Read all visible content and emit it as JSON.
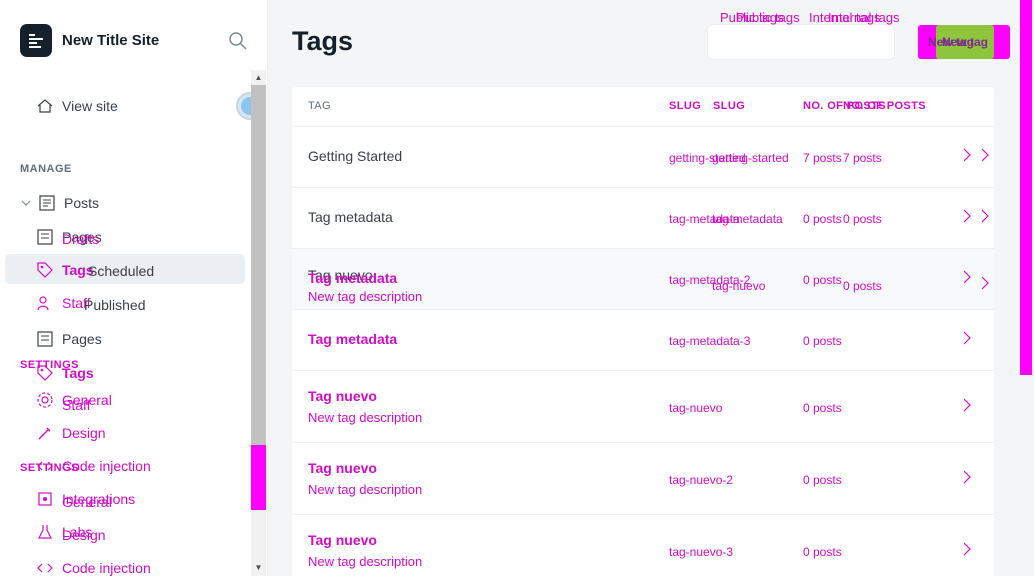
{
  "sidebar": {
    "site_title": "New Title Site",
    "view_site": "View site",
    "manage_label": "MANAGE",
    "settings_label_1": "SETTINGS",
    "settings_label_2": "SETTINGS",
    "posts": "Posts",
    "pages_ghost": "Pages",
    "drafts": "Drafts",
    "tags_ghost": "Tags",
    "scheduled": "Scheduled",
    "staff_ghost": "Staff",
    "published": "Published",
    "pages": "Pages",
    "tags": "Tags",
    "staff": "Staff",
    "general_1": "General",
    "design_1": "Design",
    "code_injection_1": "Code injection",
    "integrations": "Integrations",
    "general_2": "General",
    "labs": "Labs",
    "design_2": "Design",
    "code_injection_2": "Code injection"
  },
  "header": {
    "title": "Tags",
    "public_tags_1": "Public tags",
    "public_tags_2": "Public tags",
    "internal_tags_1": "Internal tags",
    "internal_tags_2": "Internal tags",
    "new_tag_1": "New tag",
    "new_tag_2": "New tag"
  },
  "table": {
    "col_tag": "TAG",
    "col_slug_1": "SLUG",
    "col_slug_2": "SLUG",
    "col_posts_1": "NO. OF POSTS",
    "col_posts_2": "NO. OF POSTS",
    "rows": [
      {
        "name": "Getting Started",
        "slug": "getting-started",
        "slug2": "getting-started",
        "count": "7 posts",
        "count2": "7 posts"
      },
      {
        "name": "Tag metadata",
        "slug": "tag-metadata",
        "slug2": "tag-metadata",
        "count": "0 posts",
        "count2": "0 posts"
      },
      {
        "name": "Tag nuevo",
        "name2": "Tag metadata",
        "desc": "New tag description",
        "slug": "tag-metadata-2",
        "slug2": "tag-nuevo",
        "count": "0 posts",
        "count2": "0 posts"
      },
      {
        "name": "Tag metadata",
        "slug": "tag-metadata-3",
        "count": "0 posts"
      },
      {
        "name": "Tag nuevo",
        "desc": "New tag description",
        "slug": "tag-nuevo",
        "count": "0 posts"
      },
      {
        "name": "Tag nuevo",
        "desc": "New tag description",
        "slug": "tag-nuevo-2",
        "count": "0 posts"
      },
      {
        "name": "Tag nuevo",
        "desc": "New tag description",
        "slug": "tag-nuevo-3",
        "count": "0 posts"
      }
    ]
  },
  "colors": {
    "accent_magenta": "#d20cc8",
    "brand_dark": "#15212a",
    "new_button_green": "#8fc53d",
    "active_bg": "#ebeef2"
  }
}
